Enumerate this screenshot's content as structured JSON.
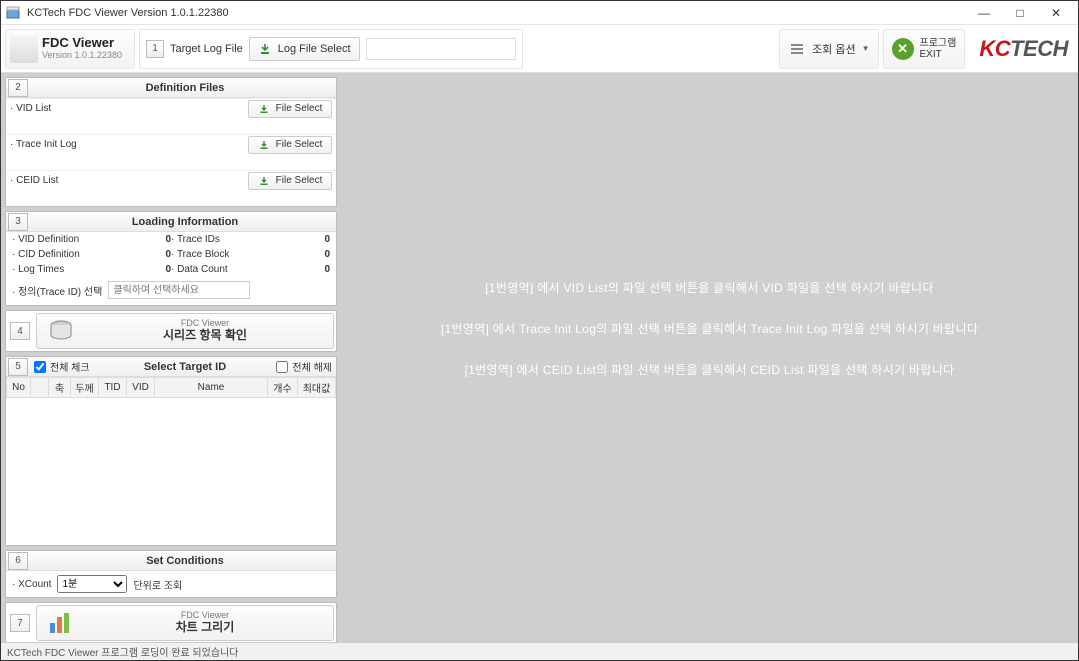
{
  "window": {
    "title": "KCTech FDC Viewer Version 1.0.1.22380",
    "min": "—",
    "max": "□",
    "close": "✕"
  },
  "brand": {
    "title": "FDC Viewer",
    "version": "Version 1.0.1.22380"
  },
  "topbar": {
    "step1_num": "1",
    "target_label": "Target Log File",
    "log_select_btn": "Log File Select",
    "options_btn": "조회 옵션",
    "exit_label1": "프로그램",
    "exit_label2": "EXIT",
    "logo_k": "KC",
    "logo_t": "TECH"
  },
  "panel2": {
    "num": "2",
    "title": "Definition Files",
    "rows": [
      {
        "label": "VID List",
        "btn": "File Select"
      },
      {
        "label": "Trace Init Log",
        "btn": "File Select"
      },
      {
        "label": "CEID List",
        "btn": "File Select"
      }
    ]
  },
  "panel3": {
    "num": "3",
    "title": "Loading Information",
    "items": [
      {
        "label": "VID Definition",
        "value": "0"
      },
      {
        "label": "Trace IDs",
        "value": "0"
      },
      {
        "label": "CID Definition",
        "value": "0"
      },
      {
        "label": "Trace Block",
        "value": "0"
      },
      {
        "label": "Log Times",
        "value": "0"
      },
      {
        "label": "Data Count",
        "value": "0"
      }
    ],
    "trace_select_label": "정의(Trace ID) 선택",
    "trace_select_placeholder": "클릭하여 선택하세요"
  },
  "panel4": {
    "num": "4",
    "sub": "FDC Viewer",
    "main": "시리즈 항목 확인"
  },
  "panel5": {
    "num": "5",
    "check_all": "전체 체크",
    "title": "Select Target ID",
    "uncheck_all": "전체 해제",
    "cols": [
      "No",
      "",
      "축",
      "두께",
      "TID",
      "VID",
      "Name",
      "개수",
      "최대값"
    ]
  },
  "panel6": {
    "num": "6",
    "title": "Set Conditions",
    "xcount_label": "XCount",
    "xcount_value": "1분",
    "xcount_unit": "단위로 조회"
  },
  "panel7": {
    "num": "7",
    "sub": "FDC Viewer",
    "main": "차트 그리기"
  },
  "right_messages": {
    "m1": "[1번영역] 에서 VID List의 파일 선택 버튼을 클릭해서 VID 파일을 선택 하시기 바랍니다",
    "m2": "[1번영역] 에서 Trace Init Log의 파일 선택 버튼을 클릭해서 Trace Init Log 파일을 선택 하시기 바랍니다",
    "m3": "[1번영역] 에서 CEID List의 파일 선택 버튼을 클릭해서 CEID List 파일을 선택 하시기 바랍니다"
  },
  "status": "KCTech FDC Viewer 프로그램 로딩이 완료 되었습니다"
}
